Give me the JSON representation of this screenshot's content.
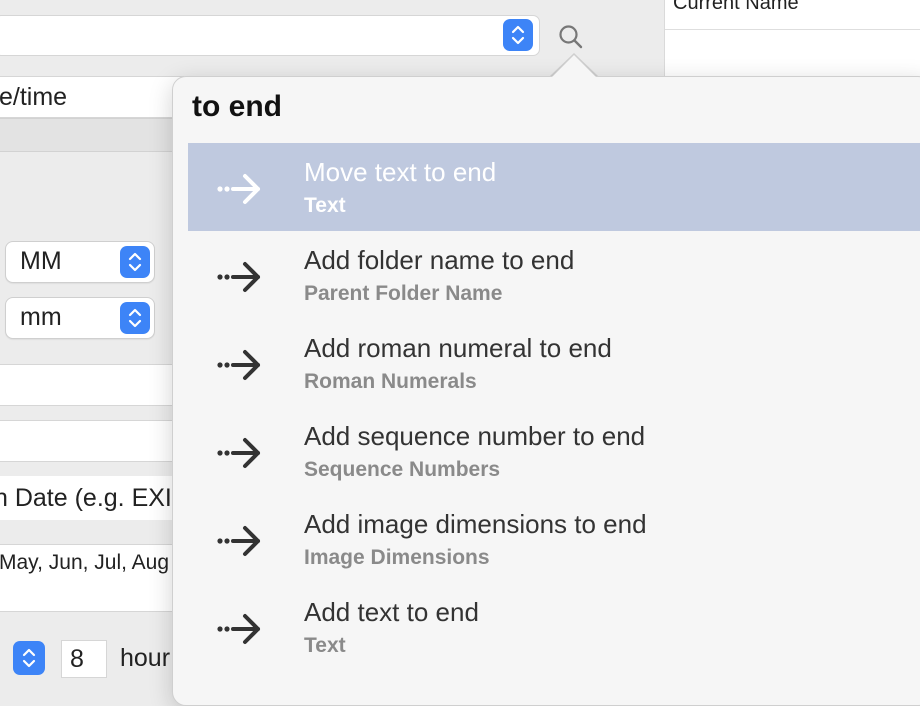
{
  "top_bar": {
    "search_icon": "search-icon",
    "stepper_icon": "up-down-chevrons-icon"
  },
  "right_panel": {
    "column_header": "Current Name"
  },
  "left_panel": {
    "field1_text": "e/time",
    "popup_month": "MM",
    "popup_minute": "mm",
    "field_date_text": "n Date (e.g. EXI",
    "field_months_text": "May, Jun, Jul, Aug",
    "hours_value": "8",
    "hours_label": "hour"
  },
  "popover": {
    "query": "to end",
    "items": [
      {
        "title": "Move text to end",
        "subtitle": "Text",
        "icon": "dotted-arrow-right-icon",
        "selected": true
      },
      {
        "title": "Add folder name to end",
        "subtitle": "Parent Folder Name",
        "icon": "dotted-arrow-right-icon"
      },
      {
        "title": "Add roman numeral to end",
        "subtitle": "Roman Numerals",
        "icon": "dotted-arrow-right-icon"
      },
      {
        "title": "Add sequence number to end",
        "subtitle": "Sequence Numbers",
        "icon": "dotted-arrow-right-icon"
      },
      {
        "title": "Add image dimensions to end",
        "subtitle": "Image Dimensions",
        "icon": "dotted-arrow-right-icon"
      },
      {
        "title": "Add text to end",
        "subtitle": "Text",
        "icon": "dotted-arrow-right-icon"
      }
    ]
  },
  "colors": {
    "accent": "#3d84f7",
    "selection": "#bfc9df",
    "popover_bg": "#f6f6f6",
    "window_bg": "#ececec"
  }
}
